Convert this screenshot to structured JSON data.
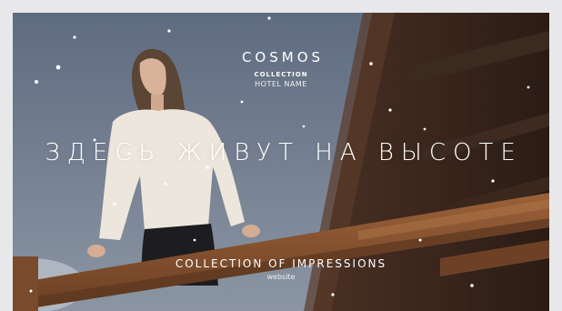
{
  "brand": {
    "name": "COSMOS",
    "collection": "COLLECTION",
    "hotel": "HOTEL NAME"
  },
  "banner": {
    "headline": "ЗДЕСЬ ЖИВУТ НА ВЫСОТЕ",
    "tagline": "COLLECTION OF IMPRESSIONS",
    "site_label": "website"
  },
  "colors": {
    "sky": "#7a8596",
    "wood": "#7a4a2c",
    "text": "#ffffff"
  }
}
